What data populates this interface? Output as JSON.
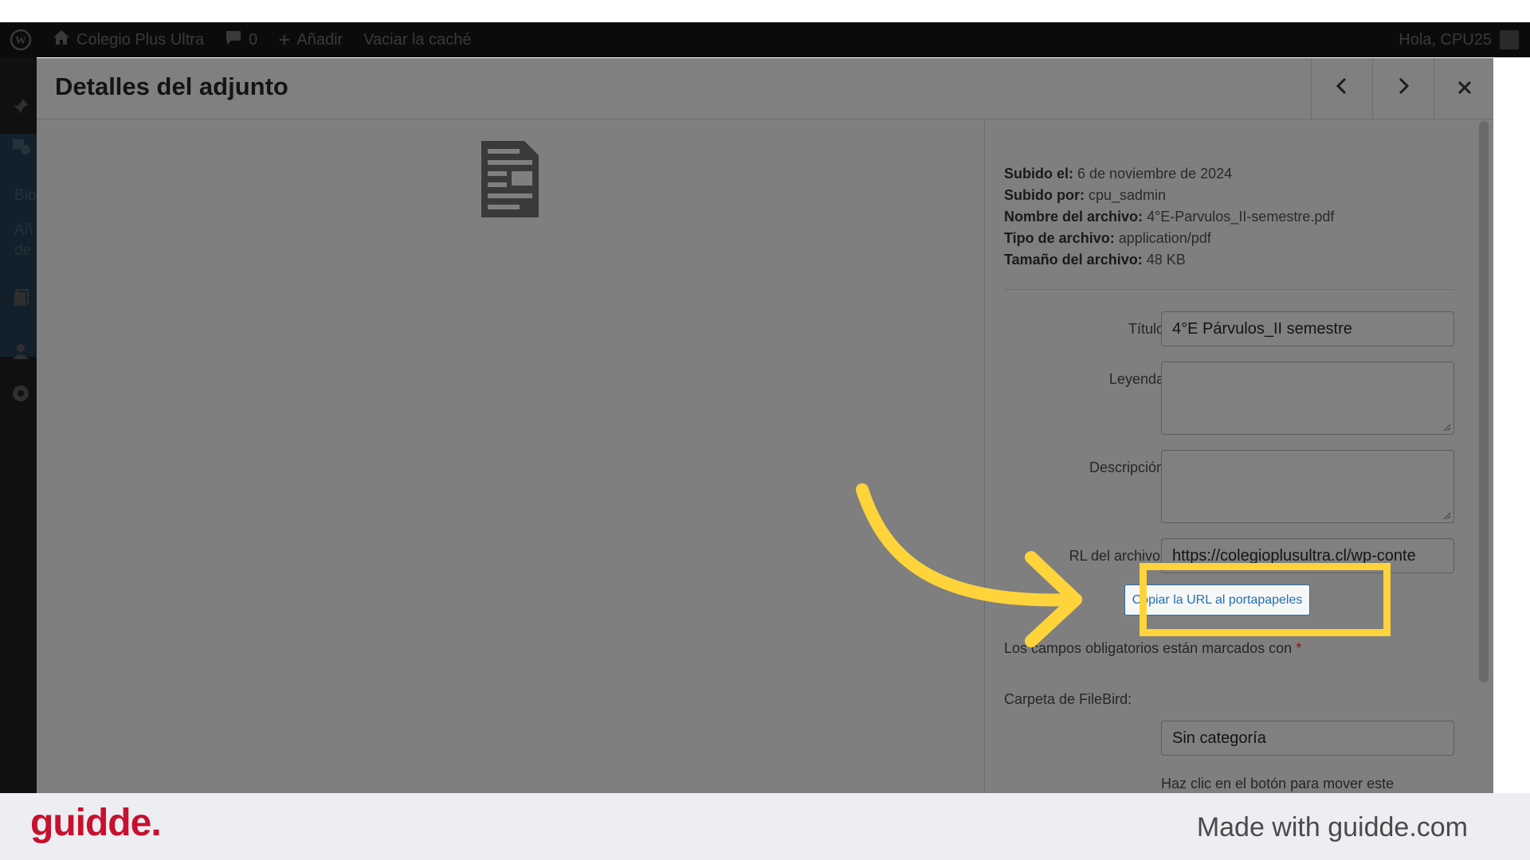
{
  "adminbar": {
    "site_name": "Colegio Plus Ultra",
    "comments_count": "0",
    "add_label": "Añadir",
    "clear_cache_label": "Vaciar la caché",
    "greeting": "Hola, CPU25"
  },
  "sidebar": {
    "library_label": "Bib",
    "add_label_line1": "Añ",
    "add_label_line2": "de"
  },
  "modal": {
    "title": "Detalles del adjunto",
    "prev_icon": "chevron-left-icon",
    "next_icon": "chevron-right-icon",
    "close_icon": "close-icon",
    "meta": {
      "uploaded_on_label": "Subido el:",
      "uploaded_on": "6 de noviembre de 2024",
      "uploaded_by_label": "Subido por:",
      "uploaded_by": "cpu_sadmin",
      "file_name_label": "Nombre del archivo:",
      "file_name": "4°E-Parvulos_II-semestre.pdf",
      "file_type_label": "Tipo de archivo:",
      "file_type": "application/pdf",
      "file_size_label": "Tamaño del archivo:",
      "file_size": "48 KB"
    },
    "fields": {
      "title_label": "Título",
      "title_value": "4°E Párvulos_II semestre",
      "caption_label": "Leyenda",
      "caption_value": "",
      "description_label": "Descripción",
      "description_value": "",
      "url_label": "RL del archivo:",
      "url_value": "https://colegioplusultra.cl/wp-conte"
    },
    "copy_url_button": "Copiar la URL al portapapeles",
    "required_note": "Los campos obligatorios están marcados con",
    "required_star": "*",
    "filebird_label": "Carpeta de FileBird:",
    "filebird_value": "Sin categoría",
    "filebird_hint": "Haz clic en el botón para mover este"
  },
  "footer": {
    "brand": "guidde.",
    "made_with": "Made with guidde.com"
  },
  "colors": {
    "highlight": "#ffd43b",
    "brand": "#c8102e",
    "link_blue": "#2271b1"
  }
}
